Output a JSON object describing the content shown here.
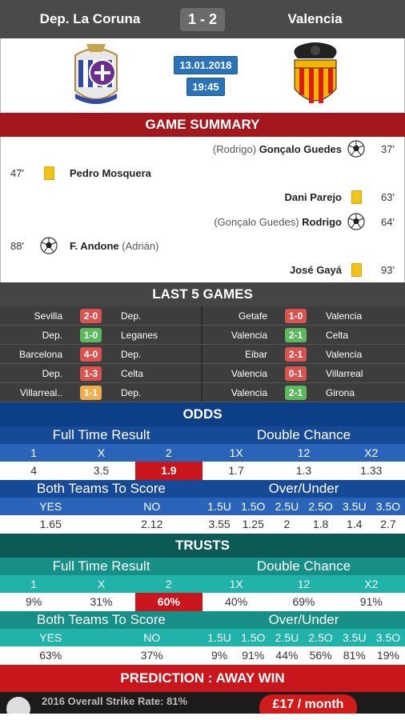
{
  "header": {
    "home": "Dep. La Coruna",
    "score": "1 - 2",
    "away": "Valencia"
  },
  "match": {
    "date": "13.01.2018",
    "time": "19:45"
  },
  "summary": {
    "title": "GAME SUMMARY",
    "events": [
      {
        "side": "right",
        "sub": "(Rodrigo)",
        "name": "Gonçalo Guedes",
        "icon": "ball-icon",
        "minute": "37'"
      },
      {
        "side": "left",
        "minute": "47'",
        "icon": "yellow-card-icon",
        "name": "Pedro Mosquera",
        "sub": ""
      },
      {
        "side": "right",
        "sub": "",
        "name": "Dani Parejo",
        "icon": "yellow-card-icon",
        "minute": "63'"
      },
      {
        "side": "right",
        "sub": "(Gonçalo Guedes)",
        "name": "Rodrigo",
        "icon": "ball-icon",
        "minute": "64'"
      },
      {
        "side": "left",
        "minute": "88'",
        "icon": "ball-icon",
        "name": "F. Andone",
        "sub": "(Adrián)"
      },
      {
        "side": "right",
        "sub": "",
        "name": "José Gayá",
        "icon": "yellow-card-icon",
        "minute": "93'"
      }
    ]
  },
  "last5": {
    "title": "LAST 5 GAMES",
    "rows": [
      [
        {
          "home": "Sevilla",
          "res": "2-0",
          "type": "L",
          "away": "Dep."
        },
        {
          "home": "Getafe",
          "res": "1-0",
          "type": "L",
          "away": "Valencia"
        }
      ],
      [
        {
          "home": "Dep.",
          "res": "1-0",
          "type": "W",
          "away": "Leganes"
        },
        {
          "home": "Valencia",
          "res": "2-1",
          "type": "W",
          "away": "Celta"
        }
      ],
      [
        {
          "home": "Barcelona",
          "res": "4-0",
          "type": "L",
          "away": "Dep."
        },
        {
          "home": "Eibar",
          "res": "2-1",
          "type": "L",
          "away": "Valencia"
        }
      ],
      [
        {
          "home": "Dep.",
          "res": "1-3",
          "type": "L",
          "away": "Celta"
        },
        {
          "home": "Valencia",
          "res": "0-1",
          "type": "L",
          "away": "Villarreal"
        }
      ],
      [
        {
          "home": "Villarreal..",
          "res": "1-1",
          "type": "D",
          "away": "Dep."
        },
        {
          "home": "Valencia",
          "res": "2-1",
          "type": "W",
          "away": "Girona"
        }
      ]
    ]
  },
  "odds": {
    "title": "ODDS",
    "ft_label": "Full Time Result",
    "dc_label": "Double Chance",
    "cols1": [
      "1",
      "X",
      "2",
      "1X",
      "12",
      "X2"
    ],
    "vals1": [
      "4",
      "3.5",
      "1.9",
      "1.7",
      "1.3",
      "1.33"
    ],
    "btts_label": "Both Teams To Score",
    "ou_label": "Over/Under",
    "cols2": [
      "YES",
      "NO"
    ],
    "ou_cols": [
      "1.5U",
      "1.5O",
      "2.5U",
      "2.5O",
      "3.5U",
      "3.5O"
    ],
    "vals2": [
      "1.65",
      "2.12"
    ],
    "ou_vals": [
      "3.55",
      "1.25",
      "2",
      "1.8",
      "1.4",
      "2.7"
    ]
  },
  "trusts": {
    "title": "TRUSTS",
    "ft_label": "Full Time Result",
    "dc_label": "Double Chance",
    "cols1": [
      "1",
      "X",
      "2",
      "1X",
      "12",
      "X2"
    ],
    "vals1": [
      "9%",
      "31%",
      "60%",
      "40%",
      "69%",
      "91%"
    ],
    "btts_label": "Both Teams To Score",
    "ou_label": "Over/Under",
    "cols2": [
      "YES",
      "NO"
    ],
    "ou_cols": [
      "1.5U",
      "1.5O",
      "2.5U",
      "2.5O",
      "3.5U",
      "3.5O"
    ],
    "vals2": [
      "63%",
      "37%"
    ],
    "ou_vals": [
      "9%",
      "91%",
      "44%",
      "56%",
      "81%",
      "19%"
    ]
  },
  "prediction": "PREDICTION : AWAY WIN",
  "banner": {
    "text": "2016 Overall Strike Rate: 81%",
    "price": "£17 / month"
  },
  "colors": {
    "red": "#c9161c",
    "blue": "#0d3f86",
    "teal": "#0b5a56"
  }
}
